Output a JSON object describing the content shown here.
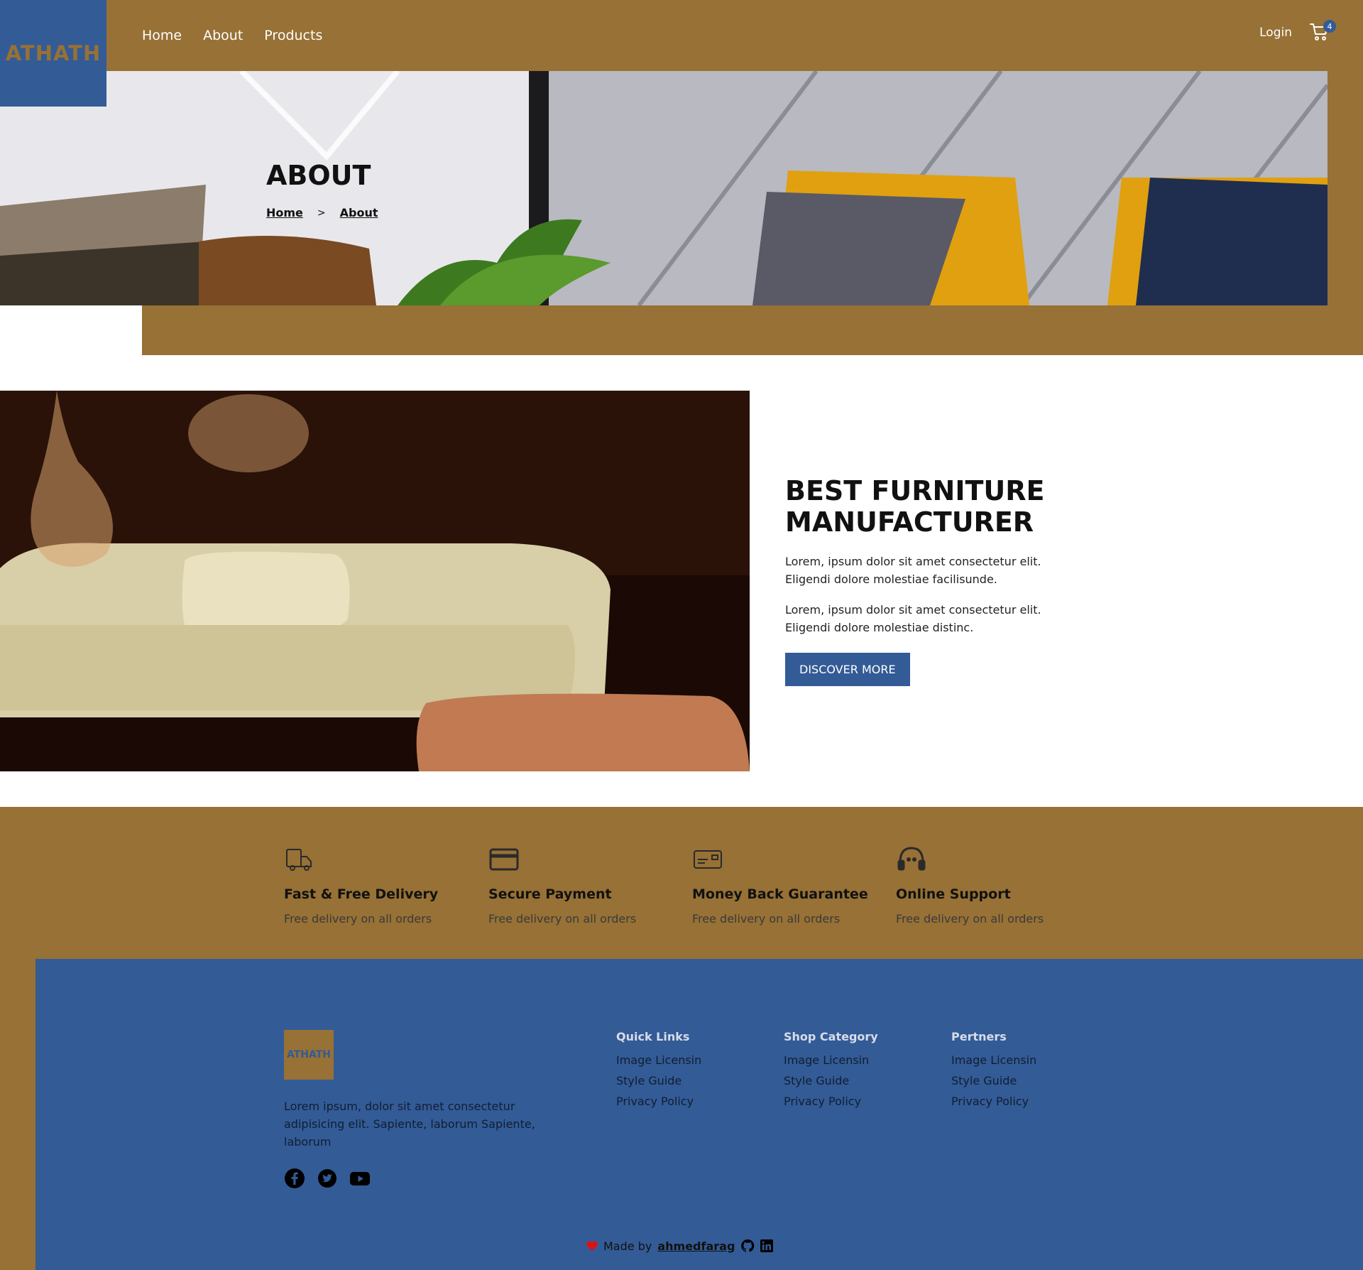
{
  "header": {
    "logo": "ATHATH",
    "nav": [
      {
        "label": "Home"
      },
      {
        "label": "About"
      },
      {
        "label": "Products"
      }
    ],
    "login": "Login",
    "cart_count": "4"
  },
  "hero": {
    "title": "ABOUT",
    "breadcrumb": {
      "home": "Home",
      "separator": ">",
      "current": "About"
    }
  },
  "about": {
    "heading_line1": "BEST FURNITURE",
    "heading_line2": "MANUFACTURER",
    "paragraph1": "Lorem, ipsum dolor sit amet consectetur elit. Eligendi dolore molestiae facilisunde.",
    "paragraph2": "Lorem, ipsum dolor sit amet consectetur elit. Eligendi dolore molestiae distinc.",
    "button": "DISCOVER MORE"
  },
  "features": [
    {
      "icon": "truck-icon",
      "title": "Fast & Free Delivery",
      "subtitle": "Free delivery on all orders"
    },
    {
      "icon": "credit-card-icon",
      "title": "Secure Payment",
      "subtitle": "Free delivery on all orders"
    },
    {
      "icon": "money-card-icon",
      "title": "Money Back Guarantee",
      "subtitle": "Free delivery on all orders"
    },
    {
      "icon": "headset-icon",
      "title": "Online Support",
      "subtitle": "Free delivery on all orders"
    }
  ],
  "footer": {
    "logo": "ATHATH",
    "description": "Lorem ipsum, dolor sit amet consectetur adipisicing elit. Sapiente, laborum Sapiente, laborum",
    "social": [
      "facebook-icon",
      "twitter-icon",
      "youtube-icon"
    ],
    "columns": [
      {
        "title": "Quick Links",
        "links": [
          "Image Licensin",
          "Style Guide",
          "Privacy Policy"
        ]
      },
      {
        "title": "Shop Category",
        "links": [
          "Image Licensin",
          "Style Guide",
          "Privacy Policy"
        ]
      },
      {
        "title": "Pertners",
        "links": [
          "Image Licensin",
          "Style Guide",
          "Privacy Policy"
        ]
      }
    ],
    "made_by_prefix": "Made by",
    "author": "ahmedfarag"
  },
  "colors": {
    "brand_brown": "#977135",
    "brand_blue": "#335b96"
  }
}
